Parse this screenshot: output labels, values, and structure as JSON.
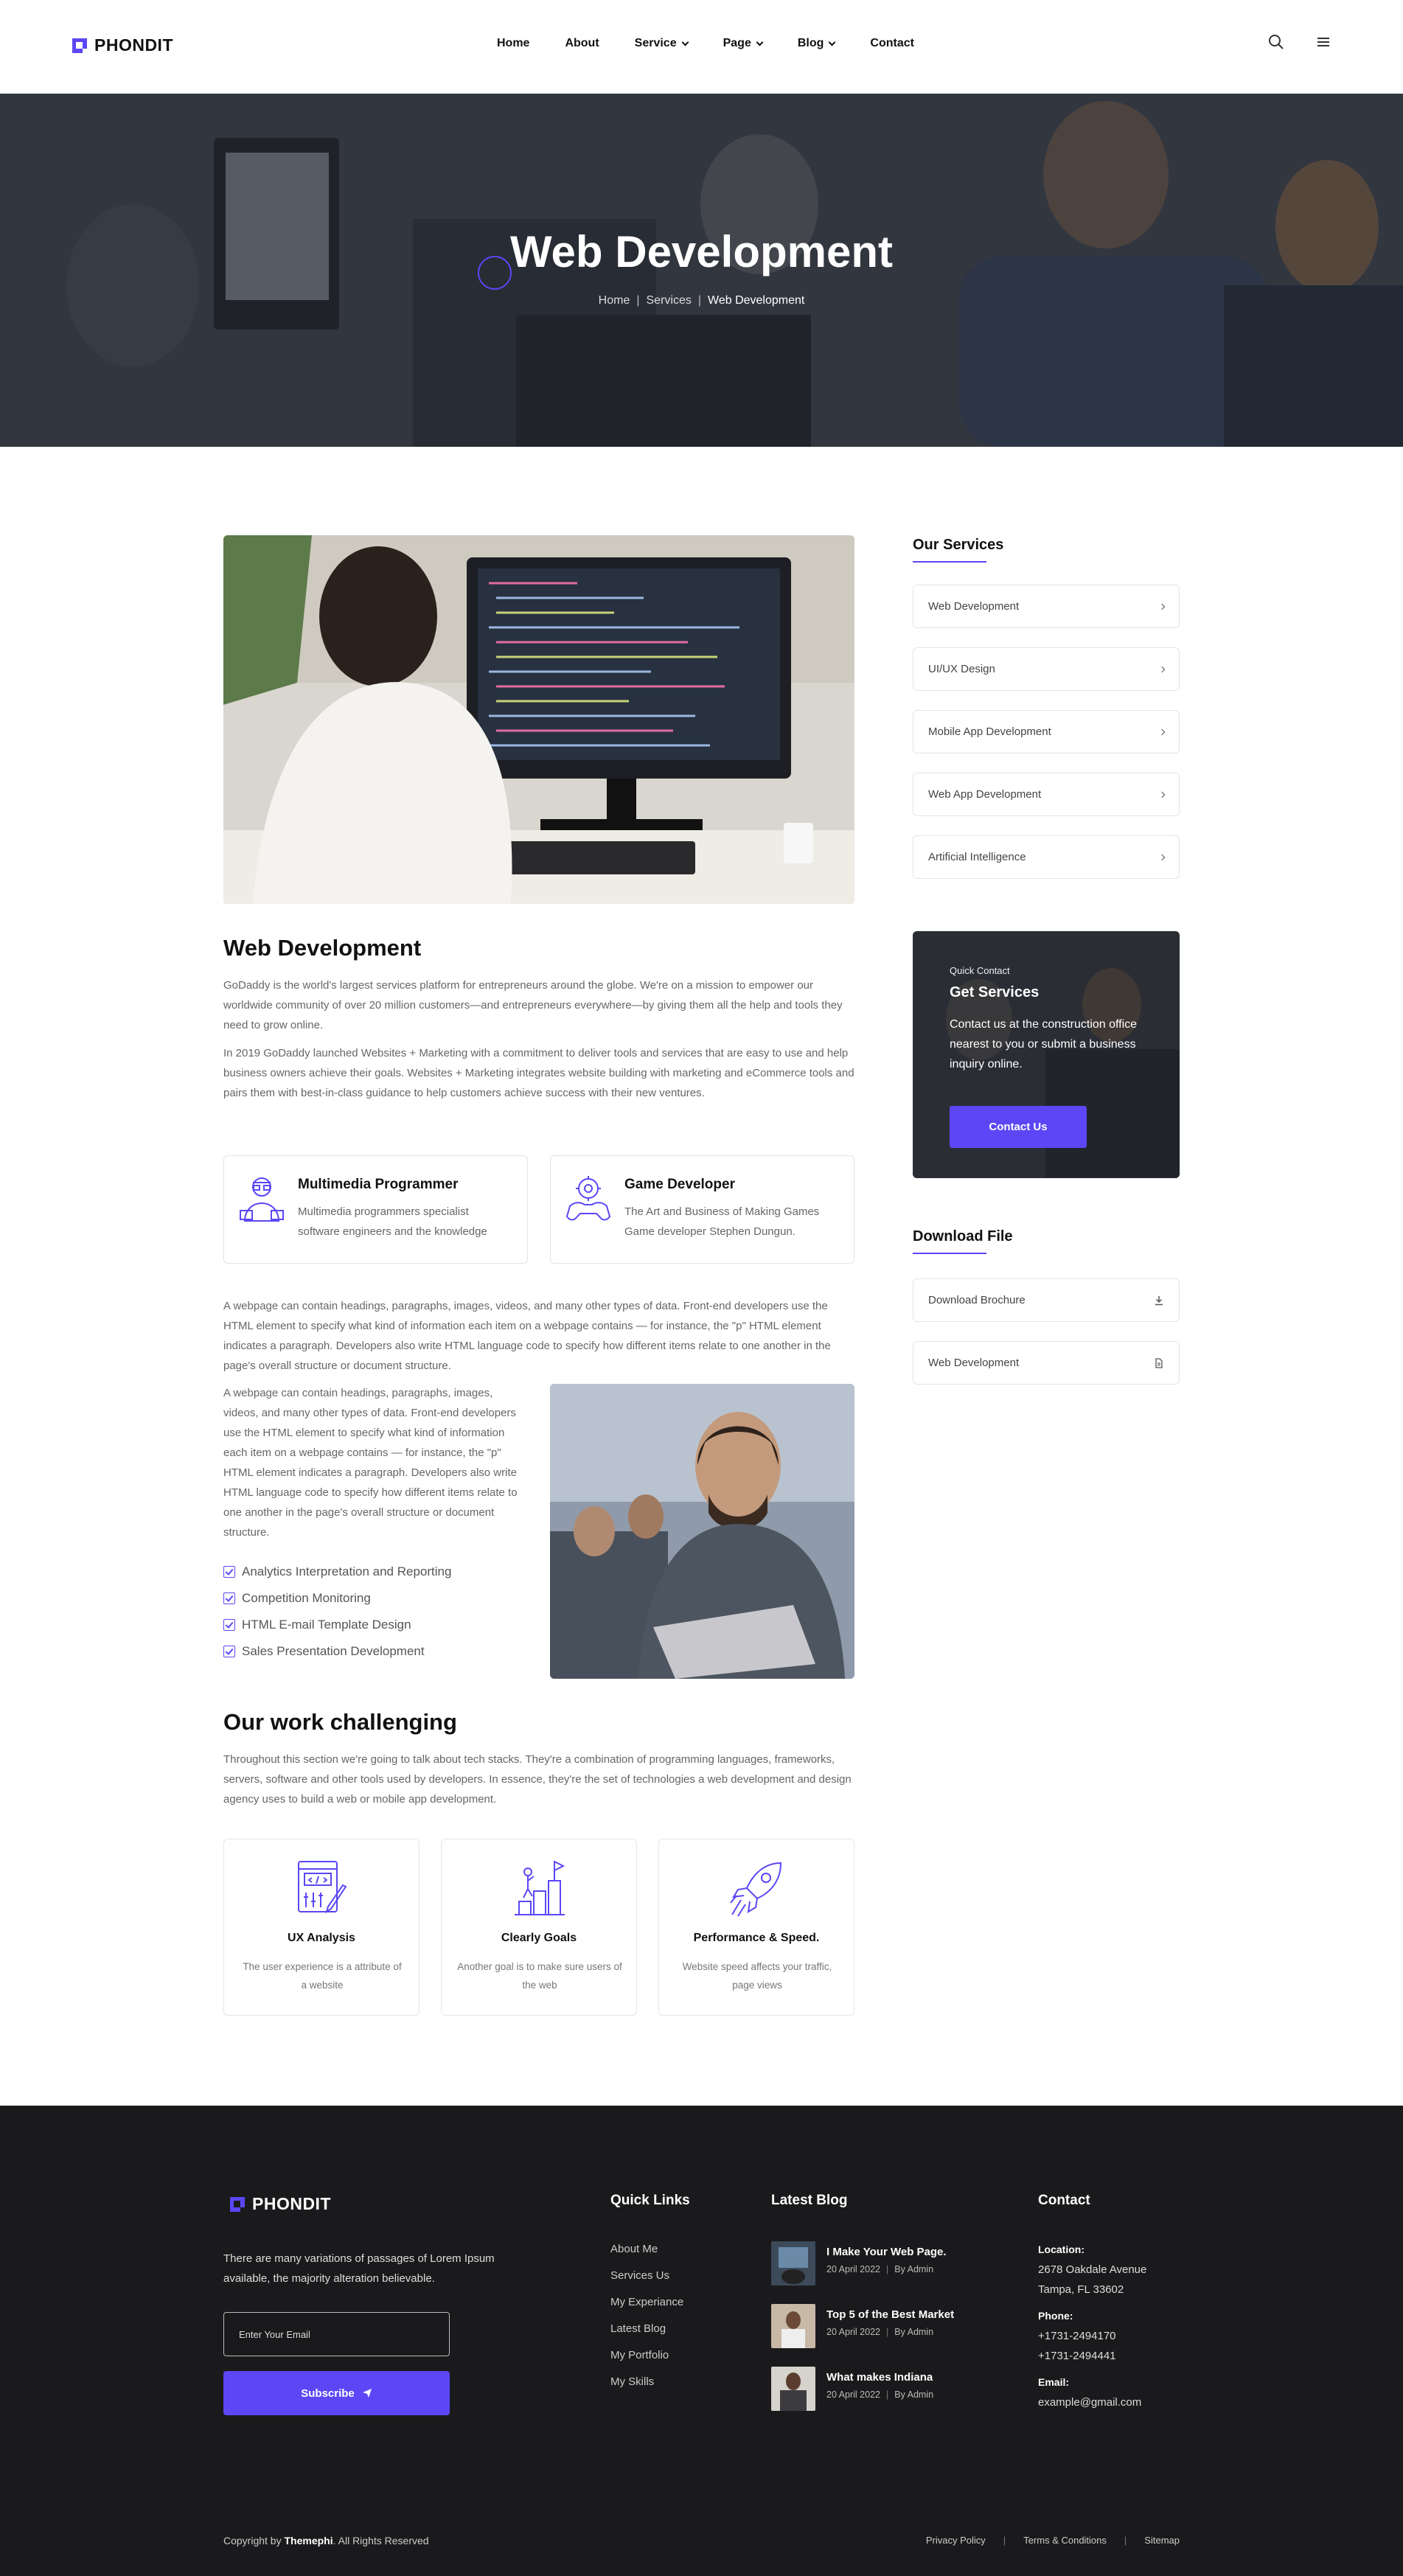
{
  "brand": {
    "name": "PHONDIT",
    "accent": "#5b47f5",
    "dark": "#1a1a1c"
  },
  "nav": {
    "items": [
      {
        "label": "Home"
      },
      {
        "label": "About"
      },
      {
        "label": "Service"
      },
      {
        "label": "Page"
      },
      {
        "label": "Blog"
      },
      {
        "label": "Contact"
      }
    ]
  },
  "hero": {
    "title": "Web Development",
    "crumbs": [
      "Home",
      "Services",
      "Web Development"
    ]
  },
  "main": {
    "title": "Web Development",
    "p1": "GoDaddy is the world's largest services platform for entrepreneurs around the globe. We're on a mission to empower our worldwide community of over 20 million customers—and entrepreneurs everywhere—by giving them all the help and tools they need to grow online.",
    "p2": "In 2019 GoDaddy launched Websites + Marketing with a commitment to deliver tools and services that are easy to use and help business owners achieve their goals. Websites + Marketing integrates website building with marketing and eCommerce tools and pairs them with best-in-class guidance to help customers achieve success with their new ventures.",
    "cards": [
      {
        "title": "Multimedia Programmer",
        "desc": "Multimedia programmers specialist software engineers and the knowledge",
        "icon": "programmer-icon"
      },
      {
        "title": "Game Developer",
        "desc": "The Art and Business of Making Games Game developer Stephen Dungun.",
        "icon": "gamepad-icon"
      }
    ],
    "p3": "A webpage can contain headings, paragraphs, images, videos, and many other types of data. Front-end developers use the HTML element to specify what kind of information each item on a webpage contains — for instance, the \"p\" HTML element indicates a paragraph. Developers also write HTML language code to specify how different items relate to one another in the page's overall structure or document structure.",
    "p4": "A webpage can contain headings, paragraphs, images, videos, and many other types of data. Front-end developers use the HTML element to specify what kind of information each item on a webpage contains — for instance, the \"p\" HTML element indicates a paragraph. Developers also write HTML language code to specify how different items relate to one another in the page's overall structure or document structure.",
    "checks": [
      "Analytics Interpretation and Reporting",
      "Competition Monitoring",
      "HTML E-mail Template Design",
      "Sales Presentation Development"
    ],
    "work_title": "Our work challenging",
    "work_p": "Throughout this section we're going to talk about tech stacks. They're a combination of programming languages, frameworks, servers, software and other tools used by developers. In essence, they're the set of technologies a web development and design agency uses to build a web or mobile app development.",
    "work": [
      {
        "title": "UX Analysis",
        "desc": "The user experience is a attribute of a website",
        "icon": "ux-analysis-icon"
      },
      {
        "title": "Clearly Goals",
        "desc": "Another goal is to make sure users of the web",
        "icon": "goal-icon"
      },
      {
        "title": "Performance & Speed.",
        "desc": "Website speed affects your traffic, page views",
        "icon": "rocket-icon"
      }
    ]
  },
  "sidebar": {
    "services_title": "Our Services",
    "services": [
      "Web Development",
      "UI/UX Design",
      "Mobile App Development",
      "Web App Development",
      "Artificial Intelligence"
    ],
    "quick": {
      "small": "Quick Contact",
      "title": "Get Services",
      "desc": "Contact us at the construction office nearest to you or submit a business inquiry online.",
      "button": "Contact Us"
    },
    "download_title": "Download File",
    "downloads": [
      "Download Brochure",
      "Web Development"
    ]
  },
  "footer": {
    "about": "There are many variations of passages of Lorem Ipsum available, the majority alteration believable.",
    "email_placeholder": "Enter Your Email",
    "subscribe": "Subscribe",
    "quick_title": "Quick Links",
    "links": [
      "About Me",
      "Services Us",
      "My Experiance",
      "Latest Blog",
      "My Portfolio",
      "My Skills"
    ],
    "blog_title": "Latest Blog",
    "posts": [
      {
        "title": "I Make Your Web Page.",
        "date": "20 April 2022",
        "by": "By Admin"
      },
      {
        "title": "Top 5 of the Best Market",
        "date": "20 April 2022",
        "by": "By Admin"
      },
      {
        "title": "What makes Indiana",
        "date": "20 April 2022",
        "by": "By Admin"
      }
    ],
    "contact_title": "Contact",
    "location_label": "Location:",
    "location": [
      "2678 Oakdale Avenue",
      "Tampa, FL 33602"
    ],
    "phone_label": "Phone:",
    "phones": [
      "+1731-2494170",
      "+1731-2494441"
    ],
    "email_label": "Email:",
    "email": "example@gmail.com",
    "copyright_pre": "Copyright by",
    "copyright_brand": "Themephi",
    "copyright_post": ". All Rights Reserved",
    "bottom_links": [
      "Privacy Policy",
      "Terms & Conditions",
      "Sitemap"
    ]
  }
}
